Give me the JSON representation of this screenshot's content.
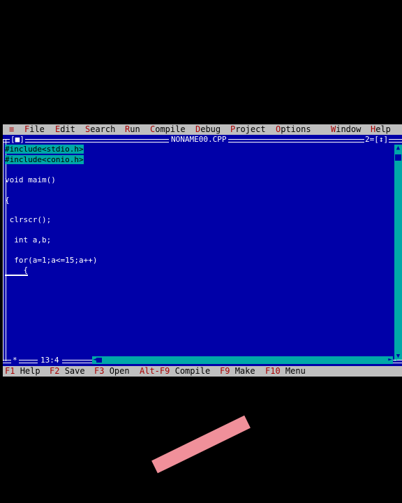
{
  "menubar": {
    "system_icon": "≡",
    "items": [
      {
        "hot": "F",
        "rest": "ile"
      },
      {
        "hot": "E",
        "rest": "dit"
      },
      {
        "hot": "S",
        "rest": "earch"
      },
      {
        "hot": "R",
        "rest": "un"
      },
      {
        "hot": "C",
        "rest": "ompile"
      },
      {
        "hot": "D",
        "rest": "ebug"
      },
      {
        "hot": "P",
        "rest": "roject"
      },
      {
        "hot": "O",
        "rest": "ptions"
      },
      {
        "hot": "W",
        "rest": "indow"
      },
      {
        "hot": "H",
        "rest": "elp"
      }
    ]
  },
  "window": {
    "close_box": "[■]",
    "title": "NONAME00.CPP",
    "number": "2=[↕]",
    "cursor_position": "13:4",
    "modified_marker": "*"
  },
  "code": {
    "lines": [
      "#include<stdio.h>",
      "#include<conio.h>",
      "void maim()",
      "{",
      " clrscr();",
      "  int a,b;",
      "  for(a=1;a<=15;a++)",
      "    {"
    ]
  },
  "statusbar": {
    "hints": [
      {
        "key": "F1",
        "label": "Help"
      },
      {
        "key": "F2",
        "label": "Save"
      },
      {
        "key": "F3",
        "label": "Open"
      },
      {
        "key": "Alt-F9",
        "label": "Compile"
      },
      {
        "key": "F9",
        "label": "Make"
      },
      {
        "key": "F10",
        "label": "Menu"
      }
    ]
  },
  "colors": {
    "editor_background": "#0000a8",
    "menu_background": "#bfbfbf",
    "hotkey": "#a80000",
    "highlight": "#00a8a8",
    "pink_stroke": "#f0909a"
  }
}
